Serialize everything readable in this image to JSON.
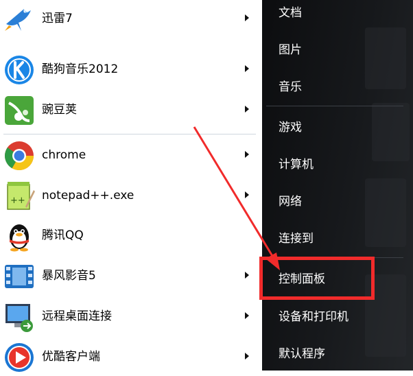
{
  "programs": [
    {
      "label": "迅雷7",
      "icon": "xunlei-bird-icon",
      "has_submenu": true
    },
    {
      "label": "酷狗音乐2012",
      "icon": "kugou-k-icon",
      "has_submenu": true
    },
    {
      "label": "豌豆荚",
      "icon": "wandoujia-pea-icon",
      "has_submenu": true
    },
    {
      "label": "chrome",
      "icon": "chrome-icon",
      "has_submenu": true
    },
    {
      "label": "notepad++.exe",
      "icon": "notepad-plus-plus-icon",
      "has_submenu": true
    },
    {
      "label": "腾讯QQ",
      "icon": "qq-penguin-icon",
      "has_submenu": false
    },
    {
      "label": "暴风影音5",
      "icon": "baofeng-film-icon",
      "has_submenu": true
    },
    {
      "label": "远程桌面连接",
      "icon": "remote-desktop-icon",
      "has_submenu": true
    },
    {
      "label": "优酷客户端",
      "icon": "youku-play-icon",
      "has_submenu": true
    }
  ],
  "right_menu": [
    {
      "label": "文档"
    },
    {
      "label": "图片"
    },
    {
      "label": "音乐"
    },
    {
      "label": "游戏"
    },
    {
      "label": "计算机"
    },
    {
      "label": "网络"
    },
    {
      "label": "连接到"
    },
    {
      "label": "控制面板"
    },
    {
      "label": "设备和打印机"
    },
    {
      "label": "默认程序"
    }
  ],
  "annotation": {
    "color": "#f12b2b",
    "target": "控制面板"
  },
  "colors": {
    "right_panel_bg": "#17191c",
    "left_panel_bg": "#ffffff"
  }
}
